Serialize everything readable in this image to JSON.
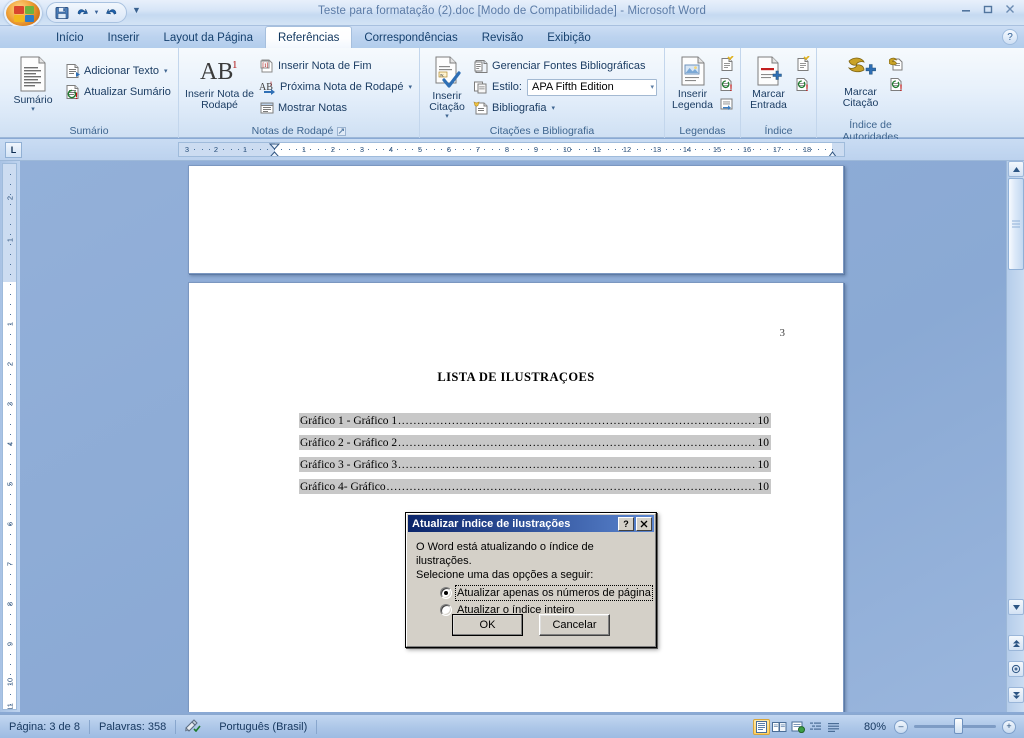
{
  "window": {
    "title": "Teste para formatação (2).doc [Modo de Compatibilidade] - Microsoft Word",
    "minimize_label": "–",
    "restore_label": "❐",
    "close_label": "✕"
  },
  "quick_access": {
    "save_label": "Salvar",
    "undo_label": "Desfazer",
    "undo_dropdown_label": "▾",
    "redo_label": "Refazer",
    "customize_label": "Personalizar Barra de Ferramentas de Acesso Rápido"
  },
  "tabs": [
    {
      "label": "Início",
      "active": false
    },
    {
      "label": "Inserir",
      "active": false
    },
    {
      "label": "Layout da Página",
      "active": false
    },
    {
      "label": "Referências",
      "active": true
    },
    {
      "label": "Correspondências",
      "active": false
    },
    {
      "label": "Revisão",
      "active": false
    },
    {
      "label": "Exibição",
      "active": false
    }
  ],
  "help": {
    "label": "?"
  },
  "ribbon": {
    "groups": [
      {
        "title": "Sumário",
        "big_button": {
          "label": "Sumário",
          "caret": "▾"
        },
        "small_buttons": [
          {
            "label": "Adicionar Texto",
            "caret": "▾"
          },
          {
            "label": "Atualizar Sumário",
            "caret": ""
          }
        ]
      },
      {
        "title": "Notas de Rodapé",
        "big_button": {
          "label": "Inserir Nota de Rodapé",
          "glyph": "AB",
          "sup": "1"
        },
        "small_buttons": [
          {
            "label": "Inserir Nota de Fim",
            "caret": ""
          },
          {
            "label": "Próxima Nota de Rodapé",
            "caret": "▾"
          },
          {
            "label": "Mostrar Notas",
            "caret": ""
          }
        ],
        "has_launcher": true
      },
      {
        "title": "Citações e Bibliografia",
        "big_button": {
          "label": "Inserir Citação",
          "caret": "▾"
        },
        "small_buttons": [
          {
            "label": "Gerenciar Fontes Bibliográficas",
            "caret": ""
          },
          {
            "label": "Estilo:",
            "caret": ""
          },
          {
            "label": "Bibliografia",
            "caret": "▾"
          }
        ],
        "style_combo": {
          "value": "APA Fifth Edition",
          "caret": "▾"
        }
      },
      {
        "title": "Legendas",
        "big_button": {
          "label": "Inserir Legenda"
        },
        "icons": [
          "inserir-indice-de-ilustracoes",
          "atualizar-indice-de-ilustracoes",
          "referencia-cruzada"
        ]
      },
      {
        "title": "Índice",
        "big_button": {
          "label": "Marcar Entrada"
        },
        "icons": [
          "inserir-indice",
          "atualizar-indice"
        ]
      },
      {
        "title": "Índice de Autoridades",
        "big_button": {
          "label": "Marcar Citação"
        },
        "icons": [
          "inserir-indice-de-autoridades",
          "atualizar-indice-de-autoridades"
        ]
      }
    ]
  },
  "ruler": {
    "tab_selector": "L",
    "horizontal_ticks": [
      "3",
      "2",
      "1",
      "1",
      "2",
      "3",
      "4",
      "5",
      "6",
      "7",
      "8",
      "9",
      "10",
      "11",
      "12",
      "13",
      "14",
      "15",
      "16",
      "17",
      "18"
    ],
    "vertical_ticks": [
      "2",
      "1",
      "1",
      "2",
      "3",
      "4",
      "5",
      "6",
      "7",
      "8",
      "9",
      "10",
      "11"
    ]
  },
  "document": {
    "page_number": "3",
    "title": "LISTA DE ILUSTRAÇOES",
    "entries": [
      {
        "text": "Gráfico 1 - Gráfico 1",
        "page": "10"
      },
      {
        "text": "Gráfico 2 - Gráfico 2",
        "page": "10"
      },
      {
        "text": "Gráfico 3 - Gráfico 3",
        "page": "10"
      },
      {
        "text": "Gráfico 4- Gráfico",
        "page": "10"
      }
    ],
    "leader": "................................................................................................................................................................"
  },
  "dialog": {
    "title": "Atualizar índice de ilustrações",
    "help_label": "?",
    "close_label": "✕",
    "message_line1": "O Word está atualizando o índice de ilustrações.",
    "message_line2": "Selecione uma das opções a seguir:",
    "options": [
      {
        "label": "Atualizar apenas os números de página",
        "selected": true
      },
      {
        "label": "Atualizar o índice inteiro",
        "selected": false
      }
    ],
    "ok_label": "OK",
    "cancel_label": "Cancelar"
  },
  "scrollbar": {
    "up_label": "▲",
    "down_label": "▼",
    "prev_page_label": "⇞",
    "select_object_label": "◉",
    "next_page_label": "⇟"
  },
  "statusbar": {
    "page_info": "Página: 3 de 8",
    "word_count": "Palavras: 358",
    "proofing_icon": "spellcheck-icon",
    "language": "Português (Brasil)",
    "view_buttons": [
      {
        "name": "print-layout-view",
        "active": true
      },
      {
        "name": "full-screen-reading-view",
        "active": false
      },
      {
        "name": "web-layout-view",
        "active": false
      },
      {
        "name": "outline-view",
        "active": false
      },
      {
        "name": "draft-view",
        "active": false
      }
    ],
    "zoom_value": "80%",
    "zoom_out_label": "–",
    "zoom_in_label": "+"
  },
  "colors": {
    "accent": "#c5d9f1",
    "chrome": "#8aa9d4",
    "dialog_title": "#0a246a",
    "highlight": "#c8c8c8"
  }
}
